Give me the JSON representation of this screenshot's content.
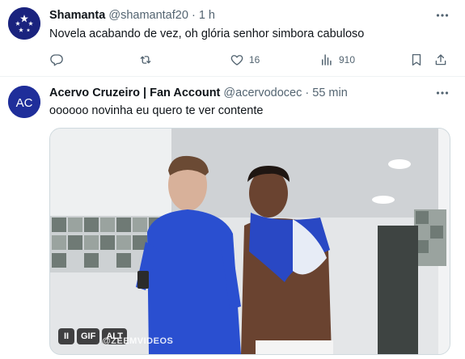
{
  "colors": {
    "text": "#0f1419",
    "muted": "#536471",
    "divider": "#eff3f4"
  },
  "tweets": [
    {
      "name": "Shamanta",
      "handle": "@shamantaf20",
      "separator": "·",
      "time": "1 h",
      "text": "Novela acabando de vez, oh glória senhor simbora cabuloso",
      "avatar_icon": "stars-avatar-icon",
      "actions": {
        "reply_count": "",
        "retweet_count": "",
        "like_count": "16",
        "views_count": "910"
      }
    },
    {
      "name": "Acervo Cruzeiro | Fan Account",
      "handle": "@acervodocec",
      "separator": "·",
      "time": "55 min",
      "text": "oooooo novinha eu quero te ver contente",
      "avatar_label": "AC",
      "media": {
        "type": "gif",
        "badges": {
          "pause": "II",
          "gif": "GIF",
          "alt": "ALT"
        },
        "watermark": "@ZEEMVIDEOS"
      }
    }
  ]
}
